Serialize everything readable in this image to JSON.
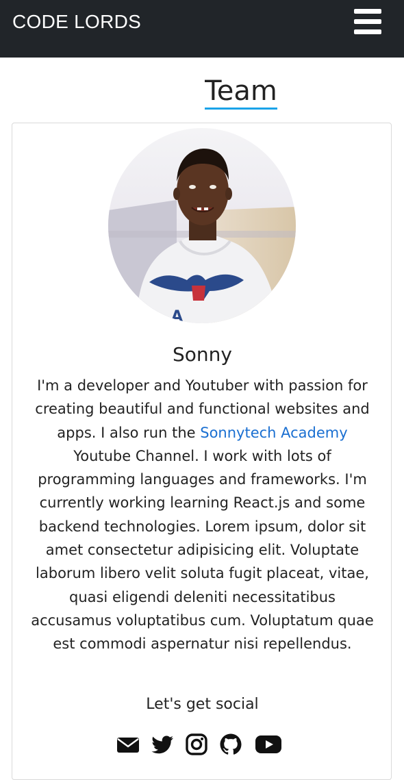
{
  "navbar": {
    "brand": "CODE LORDS"
  },
  "section": {
    "title": "Team"
  },
  "member": {
    "name": "Sonny",
    "bio_part1": "I'm a developer and Youtuber with passion for creating beautiful and functional websites and apps. I also run the ",
    "bio_link": "Sonnytech Academy",
    "bio_part2": " Youtube Channel. I work with lots of programming languages and frameworks. I'm currently working learning React.js and some backend technologies. Lorem ipsum, dolor sit amet consectetur adipisicing elit. Voluptate laborum libero velit soluta fugit placeat, vitae, quasi eligendi deleniti necessitatibus accusamus voluptatibus cum. Voluptatum quae est commodi aspernatur nisi repellendus."
  },
  "social": {
    "title": "Let's get social",
    "icons": [
      "envelope-icon",
      "twitter-icon",
      "instagram-icon",
      "github-icon",
      "youtube-icon"
    ]
  },
  "colors": {
    "navbar_bg": "#212529",
    "link": "#1a6fd1",
    "title_underline": "#1aa3e8"
  }
}
